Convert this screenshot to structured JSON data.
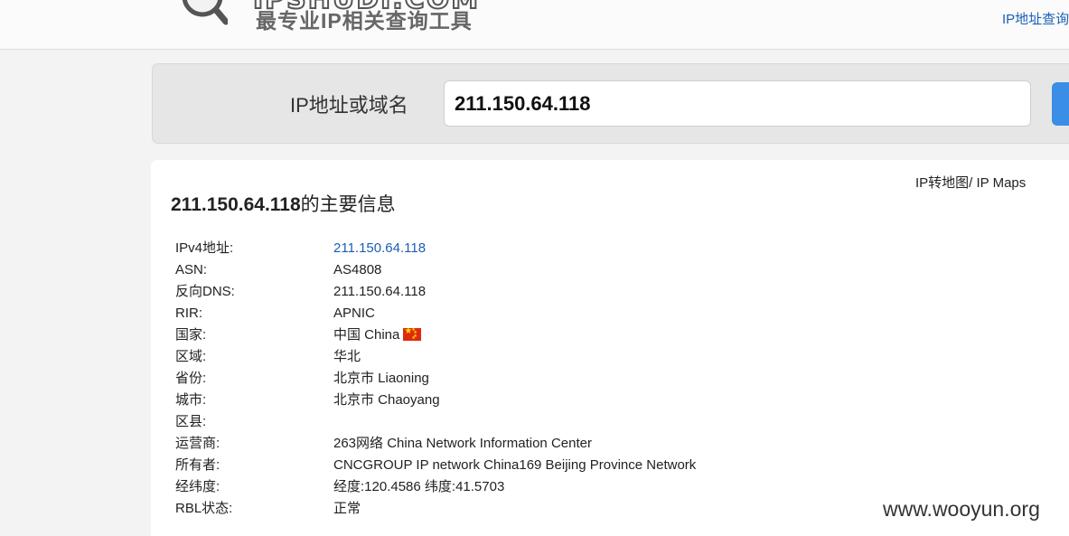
{
  "header": {
    "logo_text": "IPSHUDI.COM",
    "slogan": "最专业IP相关查询工具",
    "top_link": "IP地址查询"
  },
  "search": {
    "label": "IP地址或域名",
    "value": "211.150.64.118"
  },
  "result": {
    "maps_link": "IP转地图/ IP Maps",
    "title_ip": "211.150.64.118",
    "title_suffix": "的主要信息",
    "rows": [
      {
        "key": "IPv4地址:",
        "value": "211.150.64.118"
      },
      {
        "key": "ASN:",
        "value": "AS4808"
      },
      {
        "key": "反向DNS:",
        "value": "211.150.64.118"
      },
      {
        "key": "RIR:",
        "value": "APNIC"
      },
      {
        "key": "国家:",
        "value": "中国 China"
      },
      {
        "key": "区域:",
        "value": "华北"
      },
      {
        "key": "省份:",
        "value": "北京市 Liaoning"
      },
      {
        "key": "城市:",
        "value": "北京市 Chaoyang"
      },
      {
        "key": "区县:",
        "value": ""
      },
      {
        "key": "运营商:",
        "value": "263网络 China Network Information Center"
      },
      {
        "key": "所有者:",
        "value": "CNCGROUP IP network China169 Beijing Province Network"
      },
      {
        "key": "经纬度:",
        "value": "经度:120.4586 纬度:41.5703"
      },
      {
        "key": "RBL状态:",
        "value": "正常"
      }
    ]
  },
  "watermark": "www.wooyun.org",
  "colors": {
    "link": "#1a5fb4",
    "button": "#3a8ee6",
    "flag_red": "#de2910",
    "flag_star": "#ffde00"
  }
}
